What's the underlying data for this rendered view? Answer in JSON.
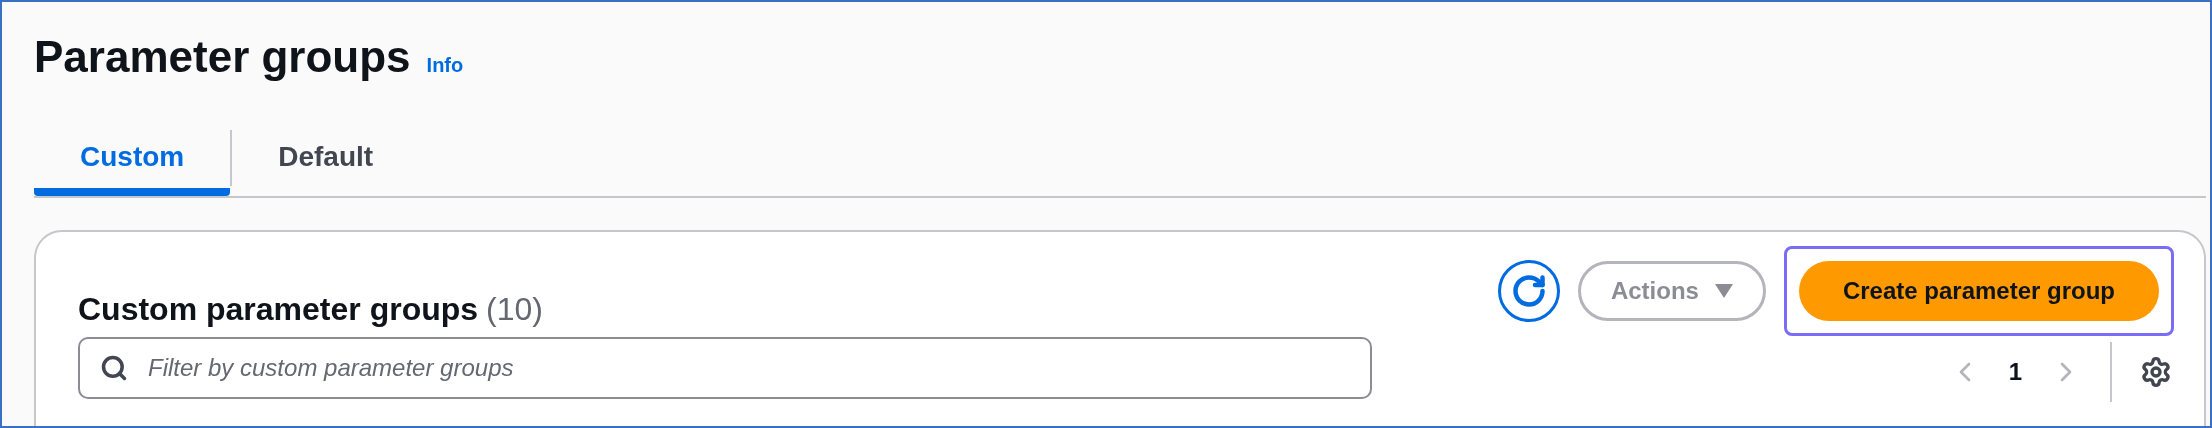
{
  "header": {
    "title": "Parameter groups",
    "info_link": "Info"
  },
  "tabs": [
    {
      "label": "Custom",
      "selected": true
    },
    {
      "label": "Default",
      "selected": false
    }
  ],
  "panel": {
    "title": "Custom parameter groups",
    "count": "(10)",
    "actions_button": {
      "label": "Actions",
      "disabled": true
    },
    "create_button": {
      "label": "Create parameter group",
      "focused": true
    },
    "search": {
      "placeholder": "Filter by custom parameter groups"
    },
    "pagination": {
      "page": "1",
      "prev_disabled": true,
      "next_disabled": true
    }
  }
}
